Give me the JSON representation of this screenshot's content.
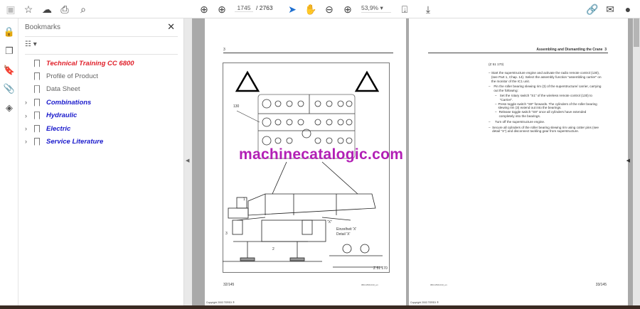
{
  "toolbar": {
    "page_current": "1745",
    "page_total": "/ 2763",
    "zoom": "53,9%"
  },
  "panel": {
    "title": "Bookmarks",
    "bookmarks": [
      {
        "label": "Technical Training CC 6800",
        "color": "#e0202a",
        "expandable": false
      },
      {
        "label": "Profile of Product",
        "color": "#666666",
        "expandable": false
      },
      {
        "label": "Data Sheet",
        "color": "#666666",
        "expandable": false
      },
      {
        "label": "Combinations",
        "color": "#1a1acc",
        "expandable": true
      },
      {
        "label": "Hydraulic",
        "color": "#1a1acc",
        "expandable": true
      },
      {
        "label": "Electric",
        "color": "#1a1acc",
        "expandable": true
      },
      {
        "label": "Service Literature",
        "color": "#1a1acc",
        "expandable": true
      }
    ]
  },
  "left_page": {
    "chapter": "3",
    "label_130": "130",
    "label_1": "1",
    "label_2": "2",
    "label_3": "3",
    "label_x": "\"X\"",
    "detail_de": "Einzelheit 'X'",
    "detail_en": "Detail 'X'",
    "fig_id": "Z 51 170",
    "page_no": "32/145",
    "doc_code": "082-1830-013_en",
    "copyright": "Copyright 2003 TEREX ®"
  },
  "right_page": {
    "header": "Assembling and Dismantling the Crane",
    "chapter": "3",
    "ref": "(Z 51 170)",
    "steps": [
      "Start the superstructure engine and activate the radio remote control (130), (see Part 1, Chap. 14). Select the assembly function \"assembling carrier\" on the monitor of the IC1 unit.",
      "Pin the roller bearing slewing rim (3) of the superstructure/ carrier, carrying out the following:",
      "Turn off the superstructure engine.",
      "Secure all cylinders of the roller bearing slewing rim using cotter pins (see detail \"X\") and disconnect tackling gear from superstructure."
    ],
    "substeps": [
      "Set the rotary switch \"S1\" of the wireless remote control (130) to \"Carrier\".",
      "Press toggle switch \"S9\" forwards. The cylinders of the roller bearing slewing rim (3) extend out into the bearings.",
      "Release toggle switch \"S9\" once all cylinders have extended completely into the bearings."
    ],
    "page_no": "33/145",
    "doc_code": "082-1830-013_en",
    "copyright": "Copyright 2003 TEREX ®"
  },
  "watermark": "machinecatalogic.com"
}
